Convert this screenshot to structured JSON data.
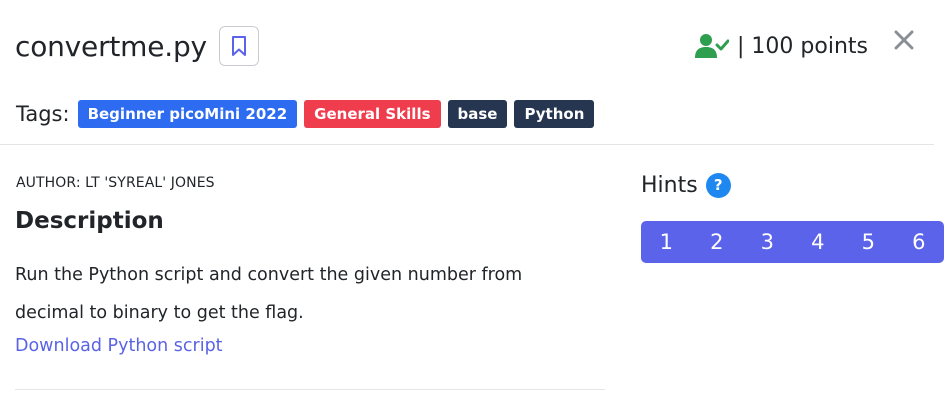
{
  "challenge": {
    "title": "convertme.py",
    "points_label": "| 100 points"
  },
  "tags": {
    "label": "Tags:",
    "items": [
      {
        "name": "Beginner picoMini 2022",
        "color": "#2d6cf0"
      },
      {
        "name": "General Skills",
        "color": "#ef3d4e"
      },
      {
        "name": "base",
        "color": "#263550"
      },
      {
        "name": "Python",
        "color": "#263550"
      }
    ]
  },
  "description": {
    "author": "AUTHOR: LT 'SYREAL' JONES",
    "heading": "Description",
    "text": "Run the Python script and convert the given number from decimal to binary to get the flag.",
    "download_link": "Download Python script"
  },
  "hints": {
    "heading": "Hints",
    "help_icon": "?",
    "buttons": [
      "1",
      "2",
      "3",
      "4",
      "5",
      "6"
    ]
  },
  "icons": {
    "bookmark": "bookmark-icon",
    "solved": "user-check-icon",
    "close": "close-icon",
    "help": "question-circle-icon"
  },
  "colors": {
    "accent": "#5b63ea",
    "link": "#5a63e6",
    "solved_green": "#2e9e4f",
    "help_blue": "#1e88f0"
  }
}
